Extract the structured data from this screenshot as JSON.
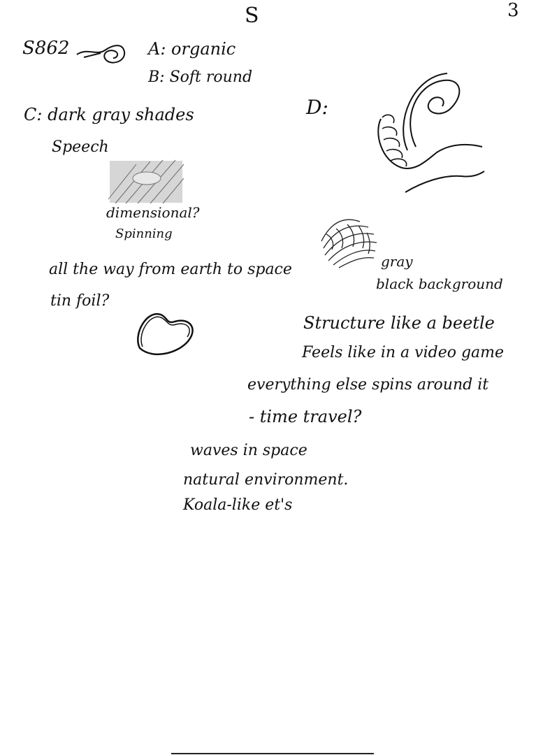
{
  "header": {
    "letter": "S",
    "page_number": "3"
  },
  "notes": {
    "id": "S862",
    "a": "A: organic",
    "b": "B: Soft round",
    "c": "C: dark gray shades",
    "speech": "Speech",
    "dimensional": "dimensional?",
    "spinning": "Spinning",
    "earth_to_space": "all the way from earth to space",
    "tin_foil": "tin foil?",
    "d": "D:",
    "gray": "gray",
    "black_background": "black background",
    "structure": "Structure like a beetle",
    "video_game": "Feels like in a video game",
    "spins_around": "everything else spins around it",
    "time_travel": "- time travel?",
    "waves": "waves in space",
    "environment": "natural environment.",
    "koala": "Koala-like et's"
  },
  "colors": {
    "ink": "#111111",
    "paper": "#ffffff",
    "shade": "#9a9a9a"
  }
}
